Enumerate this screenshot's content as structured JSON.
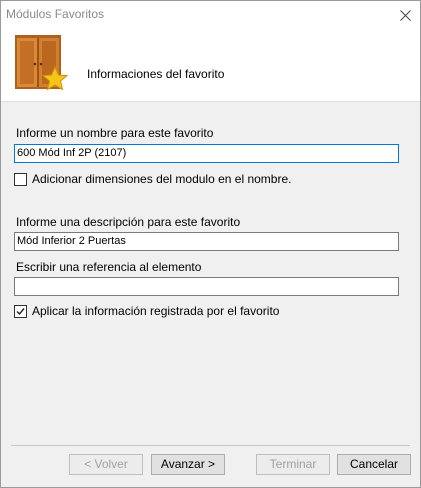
{
  "window": {
    "title": "Módulos Favoritos"
  },
  "header": {
    "title": "Informaciones del favorito",
    "icon": "wardrobe-star-icon"
  },
  "form": {
    "name_label": "Informe un nombre para este favorito",
    "name_value": "600 Mód Inf 2P (2107)",
    "add_dimensions_label": "Adicionar dimensiones del modulo en el nombre.",
    "add_dimensions_checked": false,
    "description_label": "Informe una descripción para este favorito",
    "description_value": "Mód Inferior 2 Puertas",
    "reference_label": "Escribir una referencia al elemento",
    "reference_value": "",
    "apply_info_label": "Aplicar la información registrada por el favorito",
    "apply_info_checked": true
  },
  "buttons": {
    "back": "< Volver",
    "next": "Avanzar >",
    "finish": "Terminar",
    "cancel": "Cancelar"
  },
  "colors": {
    "focus_border": "#0078d7",
    "wood": "#c8742a",
    "star": "#f5c518"
  }
}
